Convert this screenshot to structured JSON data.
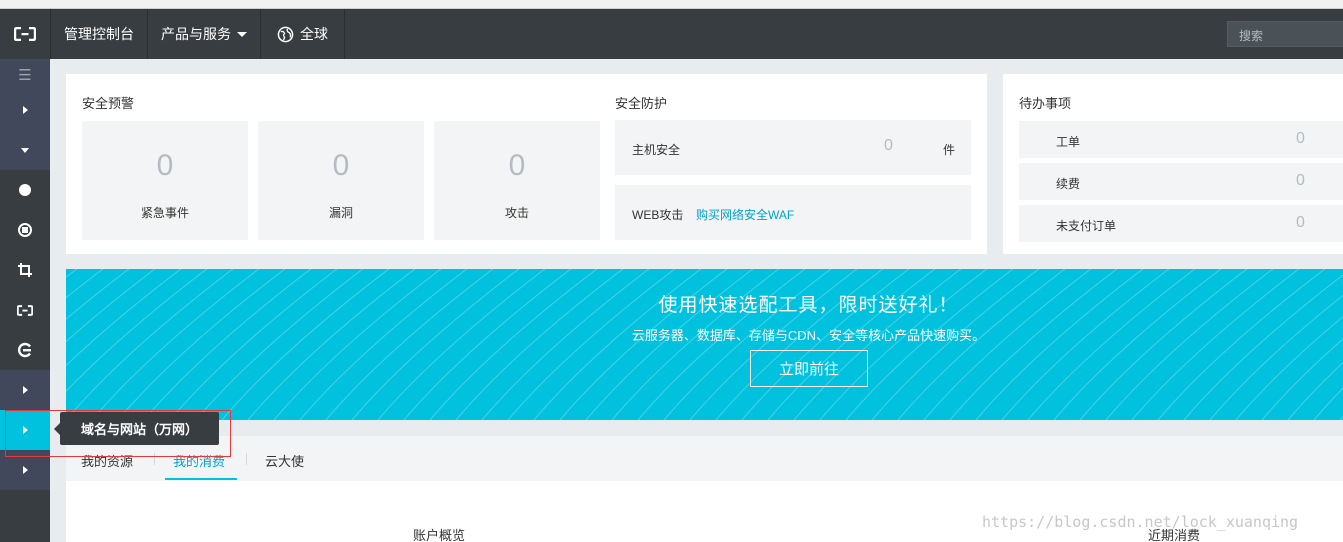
{
  "topbar": {
    "logo_icon": "aliyun-logo-icon",
    "console_label": "管理控制台",
    "products_label": "产品与服务",
    "region_label": "全球",
    "search_placeholder": "搜索"
  },
  "sidebar": {
    "menu_icon": "☰",
    "tooltip": "域名与网站（万网）"
  },
  "security_alert": {
    "title": "安全预警",
    "stats": [
      {
        "value": "0",
        "label": "紧急事件"
      },
      {
        "value": "0",
        "label": "漏洞"
      },
      {
        "value": "0",
        "label": "攻击"
      }
    ]
  },
  "security_protection": {
    "title": "安全防护",
    "host": {
      "label": "主机安全",
      "value": "0",
      "unit": "件"
    },
    "web": {
      "label": "WEB攻击",
      "link": "购买网络安全WAF"
    }
  },
  "todo": {
    "title": "待办事项",
    "items": [
      {
        "label": "工单",
        "value": "0"
      },
      {
        "label": "续费",
        "value": "0"
      },
      {
        "label": "未支付订单",
        "value": "0"
      }
    ]
  },
  "banner": {
    "title": "使用快速选配工具，限时送好礼！",
    "subtitle": "云服务器、数据库、存储与CDN、安全等核心产品快速购买。",
    "button": "立即前往"
  },
  "tabs": [
    "我的资源",
    "我的消费",
    "云大使"
  ],
  "active_tab": "我的消费",
  "bottom": {
    "account_overview": "账户概览",
    "recent_spend": "近期消费"
  },
  "watermark": "https://blog.csdn.net/lock_xuanqing",
  "colors": {
    "accent": "#00c1de",
    "topbar": "#373d41",
    "link": "#00a2ca",
    "highlight_box": "#e23b3b"
  }
}
